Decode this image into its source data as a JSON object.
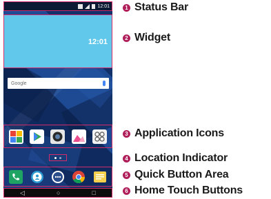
{
  "phone": {
    "status_time": "12:01",
    "widget_time": "12:01",
    "search_logo": "Google",
    "app_icons": [
      "photos-app-icon",
      "play-store-icon",
      "camera-icon",
      "gallery-icon",
      "apps-grid-icon"
    ],
    "quick_buttons": [
      "phone-icon",
      "contacts-icon",
      "app-drawer-icon",
      "chrome-icon",
      "messages-icon"
    ],
    "home_buttons": [
      "◁",
      "○",
      "□"
    ],
    "colors": {
      "highlight": "#d62b6b",
      "badge": "#b01e5a",
      "widget": "#61c8ec"
    }
  },
  "labels": [
    {
      "number": "1",
      "text": "Status Bar"
    },
    {
      "number": "2",
      "text": "Widget"
    },
    {
      "number": "3",
      "text": "Application Icons"
    },
    {
      "number": "4",
      "text": "Location Indicator"
    },
    {
      "number": "5",
      "text": "Quick Button Area"
    },
    {
      "number": "6",
      "text": "Home Touch Buttons"
    }
  ]
}
